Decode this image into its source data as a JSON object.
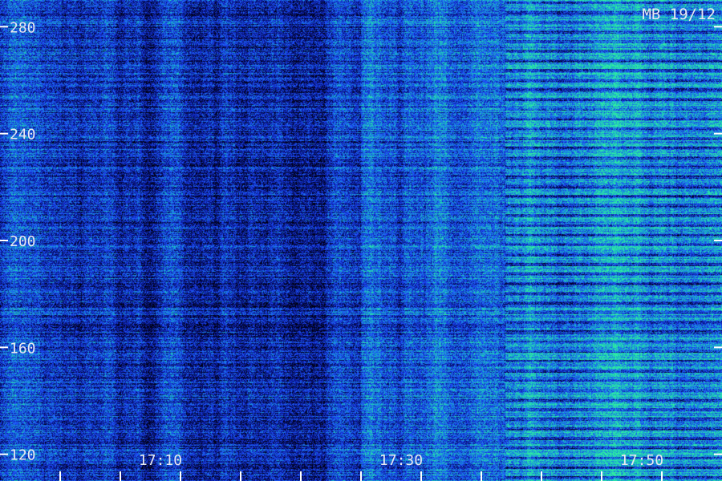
{
  "chart_data": {
    "type": "heatmap",
    "title": "MB 19/12",
    "x_ticks": [
      "17:10",
      "17:30",
      "17:50"
    ],
    "y_ticks": [
      280,
      240,
      200,
      160,
      120
    ],
    "y_range": [
      110,
      290
    ],
    "x_range": [
      "17:00",
      "18:00"
    ],
    "x_minor_ticks": [
      "17:00",
      "17:05",
      "17:10",
      "17:15",
      "17:20",
      "17:25",
      "17:30",
      "17:35",
      "17:40",
      "17:45",
      "17:50",
      "17:55"
    ],
    "colormap": [
      "#000010",
      "#0a1a9a",
      "#1f4fff",
      "#17b3c8",
      "#30f0a0"
    ],
    "grid": false,
    "segments": [
      {
        "from": "17:00",
        "to": "17:30",
        "level": 0.32
      },
      {
        "from": "17:30",
        "to": "17:42",
        "level": 0.52
      },
      {
        "from": "17:42",
        "to": "18:00",
        "level": 0.66
      }
    ]
  }
}
